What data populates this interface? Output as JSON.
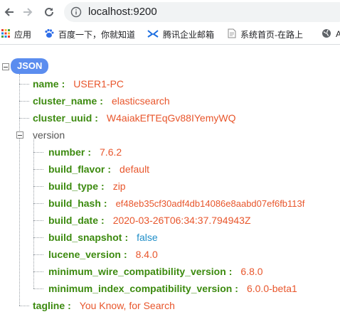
{
  "browser": {
    "url": "localhost:9200",
    "nav": {
      "back": "back-arrow",
      "forward": "forward-arrow",
      "reload": "reload-arrow"
    }
  },
  "bookmarks": [
    {
      "label": "应用",
      "icon": "apps-grid-icon"
    },
    {
      "label": "百度一下，你就知道",
      "icon": "baidu-paw-icon"
    },
    {
      "label": "腾讯企业邮箱",
      "icon": "tencent-mail-icon"
    },
    {
      "label": "系统首页-在路上",
      "icon": "page-doc-icon"
    },
    {
      "label": "A",
      "icon": "globe-icon"
    }
  ],
  "json": {
    "root_label": "JSON",
    "name": {
      "key": "name",
      "value": "USER1-PC"
    },
    "cluster_name": {
      "key": "cluster_name",
      "value": "elasticsearch"
    },
    "cluster_uuid": {
      "key": "cluster_uuid",
      "value": "W4aiakEfTEqGv88IYemyWQ"
    },
    "version": {
      "key": "version",
      "number": {
        "key": "number",
        "value": "7.6.2"
      },
      "build_flavor": {
        "key": "build_flavor",
        "value": "default"
      },
      "build_type": {
        "key": "build_type",
        "value": "zip"
      },
      "build_hash": {
        "key": "build_hash",
        "value": "ef48eb35cf30adf4db14086e8aabd07ef6fb113f"
      },
      "build_date": {
        "key": "build_date",
        "value": "2020-03-26T06:34:37.794943Z"
      },
      "build_snapshot": {
        "key": "build_snapshot",
        "value": "false"
      },
      "lucene_version": {
        "key": "lucene_version",
        "value": "8.4.0"
      },
      "minimum_wire_compatibility_version": {
        "key": "minimum_wire_compatibility_version",
        "value": "6.8.0"
      },
      "minimum_index_compatibility_version": {
        "key": "minimum_index_compatibility_version",
        "value": "6.0.0-beta1"
      }
    },
    "tagline": {
      "key": "tagline",
      "value": "You Know, for Search"
    }
  },
  "colors": {
    "key": "#3c8a0f",
    "string": "#e8562c",
    "boolean": "#1f8ec8",
    "badge": "#5b8def"
  }
}
